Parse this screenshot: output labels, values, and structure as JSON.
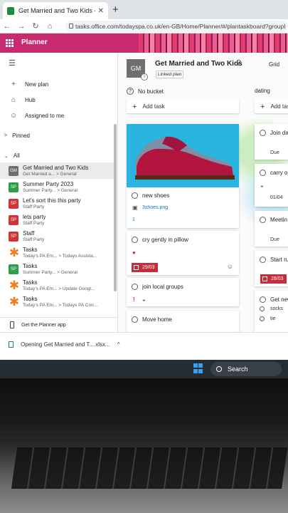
{
  "browser": {
    "tab_title": "Get Married and Two Kids - Planner",
    "url": "tasks.office.com/todayspa.co.uk/en-GB/Home/Planner/#/plantaskboard?groupI"
  },
  "app": {
    "name": "Planner"
  },
  "sidebar": {
    "new_plan": "New plan",
    "hub": "Hub",
    "assigned": "Assigned to me",
    "pinned": "Pinned",
    "all": "All",
    "plans": [
      {
        "abbr": "GM",
        "color": "#6f6f6f",
        "name": "Get Married and Two Kids",
        "sub": "Get Married a...  >  General"
      },
      {
        "abbr": "SP",
        "color": "#2e9e49",
        "name": "Summer Party 2023",
        "sub": "Summer Party...  >  General"
      },
      {
        "abbr": "SP",
        "color": "#d13438",
        "name": "Let's sort this this party",
        "sub": "Staff Party"
      },
      {
        "abbr": "SP",
        "color": "#d13438",
        "name": "lets party",
        "sub": "Staff Party"
      },
      {
        "abbr": "SP",
        "color": "#d13438",
        "name": "Staff",
        "sub": "Staff Party"
      },
      {
        "abbr": "",
        "color": "#f0801f",
        "name": "Tasks",
        "sub": "Today's PA Em...  >  Todays Assista..."
      },
      {
        "abbr": "SP",
        "color": "#2e9e49",
        "name": "Tasks",
        "sub": "Summer Party...  >  General"
      },
      {
        "abbr": "",
        "color": "#f0801f",
        "name": "Tasks",
        "sub": "Today's PA Em...  >  Update Googl..."
      },
      {
        "abbr": "",
        "color": "#f0801f",
        "name": "Tasks",
        "sub": "Today's PA Em...  >  Todays PA Con..."
      }
    ],
    "get_app": "Get the Planner app"
  },
  "plan": {
    "abbr": "GM",
    "title": "Get Married and Two Kids",
    "linked": "Linked plan",
    "view": "Grid"
  },
  "board": {
    "bucket1": "No bucket",
    "bucket2": "dating",
    "add_task": "Add task",
    "cards": [
      {
        "title": "new shoes",
        "attachment": "3shoes.png",
        "count": "1"
      },
      {
        "title": "cry gently in pillow",
        "date": "29/03"
      },
      {
        "title": "join local groups"
      },
      {
        "title": "Move home"
      }
    ],
    "col2": [
      {
        "title": "Join da",
        "label": "Due"
      },
      {
        "title": "carry or",
        "label": "01/04"
      },
      {
        "title": "Meetin",
        "label": "Due"
      },
      {
        "title": "Start ru",
        "label": "28/03"
      },
      {
        "title": "Get new",
        "items": [
          "socks",
          "tie"
        ]
      }
    ]
  },
  "downloads": {
    "text": "Opening Get Married and T....xlsx..."
  },
  "taskbar": {
    "search": "Search"
  }
}
